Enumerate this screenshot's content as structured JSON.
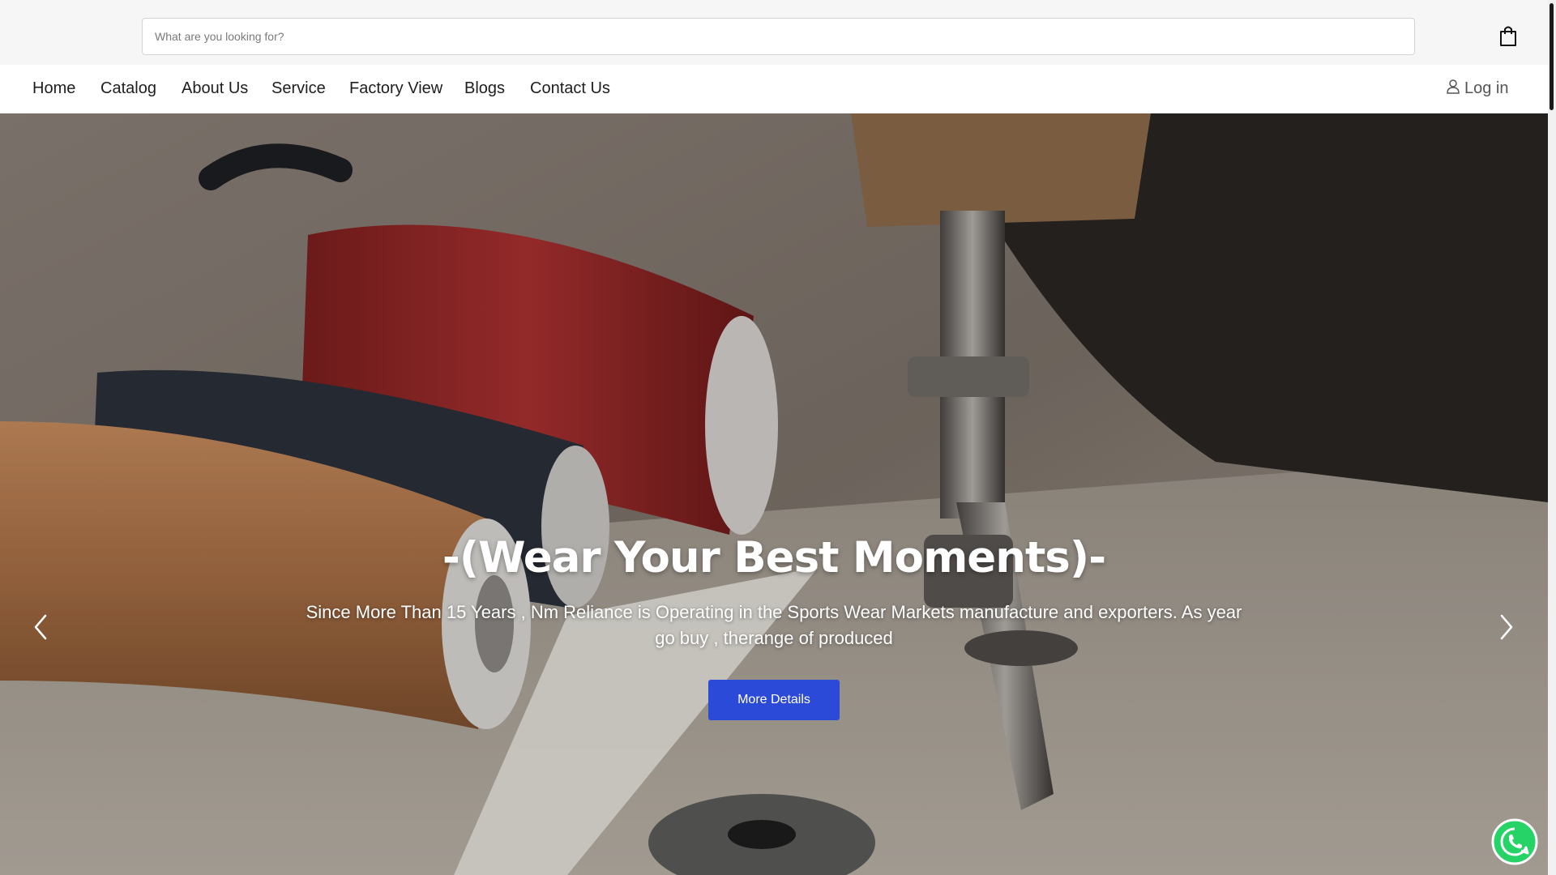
{
  "search": {
    "placeholder": "What are you looking for?"
  },
  "header": {
    "cart_icon": "shopping-bag-icon"
  },
  "nav": {
    "items": [
      {
        "label": "Home"
      },
      {
        "label": "Catalog"
      },
      {
        "label": "About Us"
      },
      {
        "label": "Service"
      },
      {
        "label": "Factory View"
      },
      {
        "label": "Blogs"
      },
      {
        "label": "Contact Us"
      }
    ],
    "login_label": "Log in",
    "login_icon": "user-icon"
  },
  "hero": {
    "title": "-(Wear Your Best Moments)-",
    "description": "Since More Than 15 Years , Nm Reliance is Operating in the Sports Wear Markets manufacture and exporters. As year go buy , therange of produced",
    "button_label": "More Details",
    "prev_icon": "chevron-left-icon",
    "next_icon": "chevron-right-icon"
  },
  "floating": {
    "whatsapp_icon": "whatsapp-icon"
  },
  "colors": {
    "accent": "#2c4ad8",
    "whatsapp": "#25d366",
    "topbar": "#f6f6f6"
  }
}
